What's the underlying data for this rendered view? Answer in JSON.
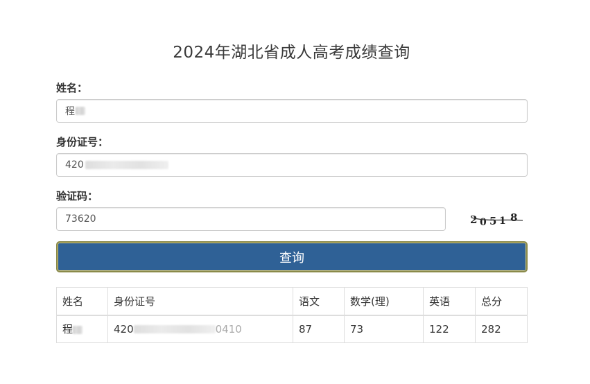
{
  "page": {
    "title": "2024年湖北省成人高考成绩查询"
  },
  "form": {
    "name_label": "姓名：",
    "name_value_visible": "程",
    "id_label": "身份证号：",
    "id_value_visible": "420",
    "captcha_label": "验证码：",
    "captcha_value": "73620",
    "captcha_image_text": "20518",
    "submit_label": "查询"
  },
  "result": {
    "headers": [
      "姓名",
      "身份证号",
      "语文",
      "数学(理)",
      "英语",
      "总分"
    ],
    "row": {
      "name_visible": "程",
      "id_visible_prefix": "420",
      "id_visible_suffix": "0410",
      "chinese": "87",
      "math": "73",
      "english": "122",
      "total": "282"
    }
  },
  "colors": {
    "button_bg": "#2f6196",
    "button_border": "#8a8a4a"
  }
}
